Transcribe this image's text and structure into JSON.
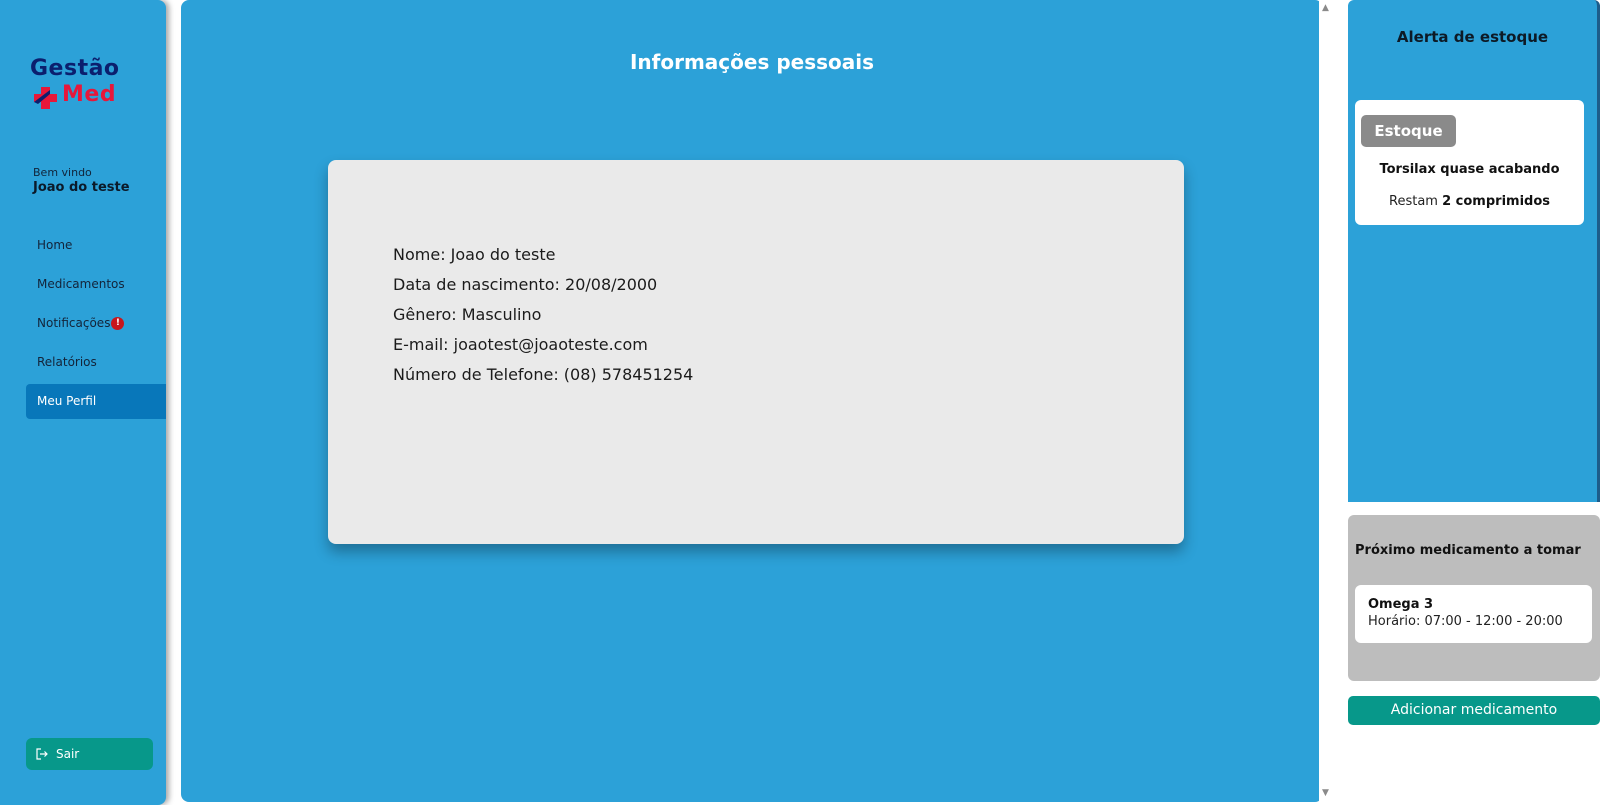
{
  "brand": {
    "logo_line1": "Gestão",
    "logo_line2": "Med"
  },
  "user": {
    "greeting": "Bem vindo",
    "name": "Joao do teste"
  },
  "nav": {
    "items": [
      {
        "label": "Home"
      },
      {
        "label": "Medicamentos"
      },
      {
        "label": "Notificações",
        "badge": "!"
      },
      {
        "label": "Relatórios"
      },
      {
        "label": "Meu Perfil"
      }
    ],
    "logout_label": "Sair"
  },
  "main": {
    "title": "Informações pessoais",
    "fields": [
      "Nome: Joao do teste",
      "Data de nascimento: 20/08/2000",
      "Gênero: Masculino",
      "E-mail: joaotest@joaoteste.com",
      "Número de Telefone: (08) 578451254"
    ]
  },
  "alerts": {
    "title": "Alerta de estoque",
    "tag": "Estoque",
    "message": "Torsilax quase acabando",
    "remaining_prefix": "Restam",
    "remaining_value": "2 comprimidos"
  },
  "next_med": {
    "title": "Próximo medicamento a tomar",
    "name": "Omega 3",
    "schedule": "Horário: 07:00 - 12:00 - 20:00"
  },
  "actions": {
    "add_med_label": "Adicionar medicamento"
  },
  "colors": {
    "primary": "#2ca1d8",
    "active_nav": "#0877ba",
    "teal_button": "#07988a",
    "brand_navy": "#0b1f6e",
    "brand_red": "#e8173a",
    "card_bg": "#eaeaea"
  }
}
